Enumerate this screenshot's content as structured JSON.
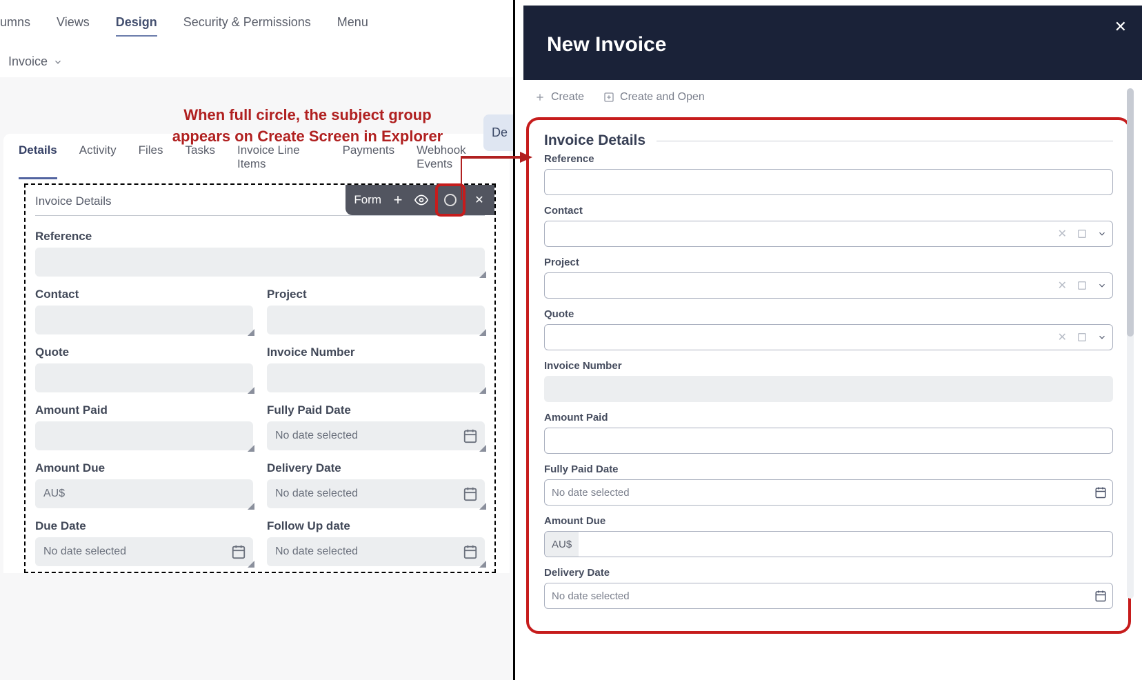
{
  "topTabs": {
    "t0": "umns",
    "t1": "Views",
    "t2": "Design",
    "t3": "Security & Permissions",
    "t4": "Menu"
  },
  "invoiceDropdown": "Invoice",
  "annotation": "When full circle, the subject group appears on Create Screen in Explorer",
  "deButton": "De",
  "detailTabs": {
    "t0": "Details",
    "t1": "Activity",
    "t2": "Files",
    "t3": "Tasks",
    "t4": "Invoice Line Items",
    "t5": "Payments",
    "t6": "Webhook Events"
  },
  "formToolbarLabel": "Form",
  "designForm": {
    "sectionTitle": "Invoice Details",
    "reference": "Reference",
    "contact": "Contact",
    "project": "Project",
    "quote": "Quote",
    "invoiceNumber": "Invoice Number",
    "amountPaid": "Amount Paid",
    "fullyPaidDate": "Fully Paid Date",
    "amountDue": "Amount Due",
    "deliveryDate": "Delivery Date",
    "dueDate": "Due Date",
    "followUpDate": "Follow Up date",
    "noDate": "No date selected",
    "auPrefix": "AU$"
  },
  "rightPanel": {
    "headerTitle": "New Invoice",
    "create": "Create",
    "createAndOpen": "Create and Open",
    "sectionTitle": "Invoice Details",
    "reference": "Reference",
    "contact": "Contact",
    "project": "Project",
    "quote": "Quote",
    "invoiceNumber": "Invoice Number",
    "amountPaid": "Amount Paid",
    "fullyPaidDate": "Fully Paid Date",
    "amountDue": "Amount Due",
    "deliveryDate": "Delivery Date",
    "noDate": "No date selected",
    "auPrefix": "AU$"
  }
}
